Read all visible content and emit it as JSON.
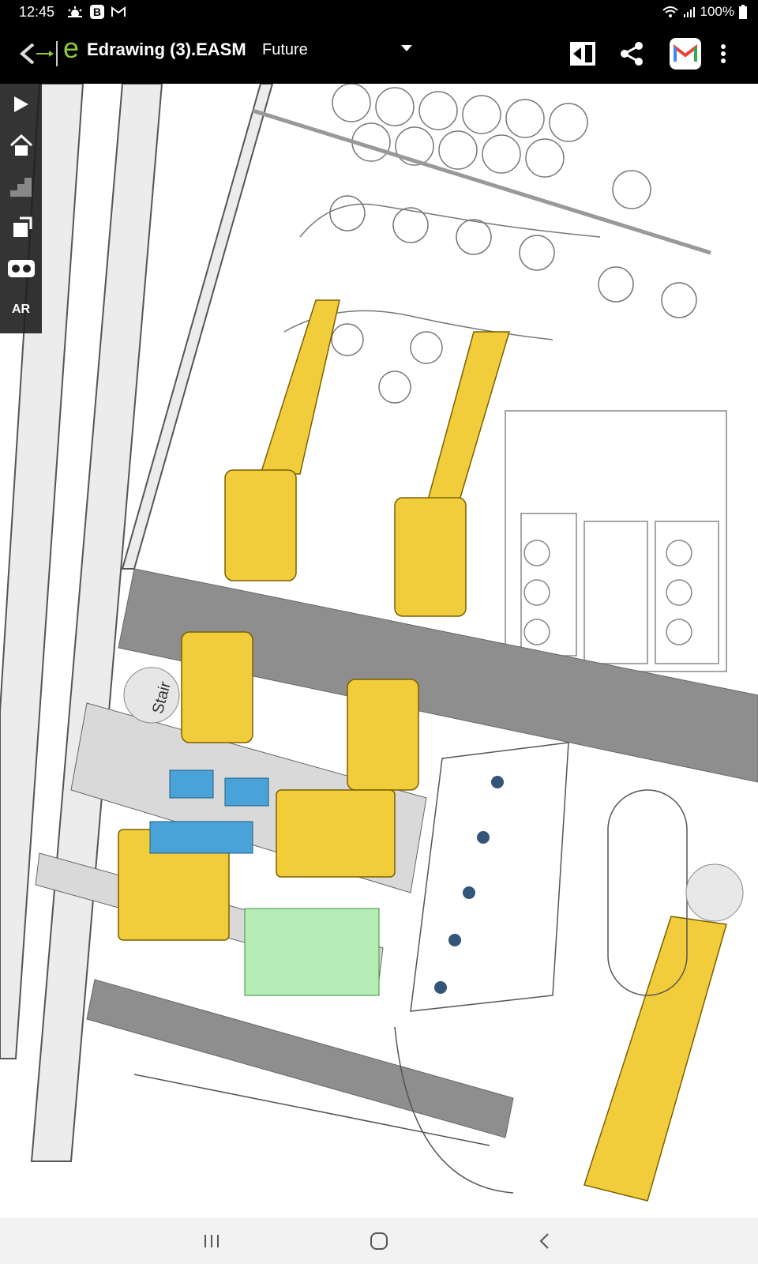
{
  "status_bar": {
    "time": "12:45",
    "notification_icons": [
      "weather-icon",
      "b-app-icon",
      "gmail-notification-icon"
    ],
    "battery": "100%",
    "signal_icons": [
      "wifi-icon",
      "cellular-signal-icon",
      "battery-icon"
    ]
  },
  "app_bar": {
    "back_icon": "back-arrow-icon",
    "logo_letter": "e",
    "title": "Edrawing (3).EASM",
    "configuration": "Future",
    "actions": [
      "exit-fullscreen-icon",
      "share-icon",
      "gmail-icon",
      "more-vert-icon"
    ]
  },
  "toolbar": {
    "items": [
      "play-icon",
      "home-icon",
      "steps-icon",
      "views-icon",
      "vr-icon"
    ],
    "ar_label": "AR"
  },
  "drawing": {
    "stair_label": "Stair"
  },
  "nav_bar": {
    "items": [
      "recent-apps-icon",
      "home-icon",
      "back-icon"
    ]
  },
  "colors": {
    "bar_background": "#000000",
    "accent_green": "#8dc63f",
    "machine_yellow": "#f2cd3b",
    "floor_gray": "#8e8e8e",
    "blue_equipment": "#4aa3d8",
    "green_equipment": "#b6ecb6"
  }
}
